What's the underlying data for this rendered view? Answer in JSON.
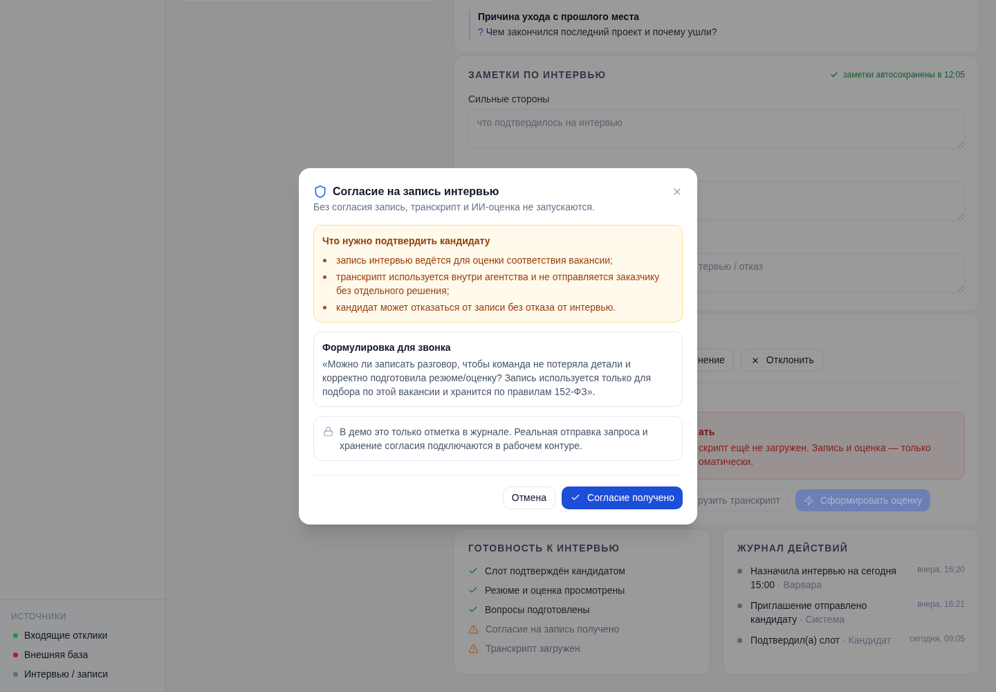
{
  "sidebar": {
    "sources": {
      "title": "ИСТОЧНИКИ",
      "items": [
        {
          "label": "Входящие отклики",
          "color": "#1a9a3c"
        },
        {
          "label": "Внешняя база",
          "color": "#a82424"
        },
        {
          "label": "Интервью / записи",
          "color": "#636b7e"
        }
      ]
    }
  },
  "questions": [
    {
      "title": "Причина ухода с прошлого места",
      "mark": "?",
      "text": "Чем закончился последний проект и почему ушли?"
    }
  ],
  "notes": {
    "title": "ЗАМЕТКИ ПО ИНТЕРВЬЮ",
    "autosave": "заметки автосохранены в 12:05",
    "fields": [
      {
        "kind": "full",
        "label": "Сильные стороны",
        "placeholder": "что подтвердилось на интервью"
      },
      {
        "kind": "covered"
      },
      {
        "kind": "covered",
        "placeholder": "тервью / отказ"
      }
    ]
  },
  "action_card": {
    "buttons": [
      {
        "kind": "covered",
        "label": "нение",
        "disabled": false
      },
      {
        "kind": "reject",
        "label": "Отклонить",
        "disabled": false
      }
    ],
    "alert": {
      "title": "ать",
      "lines": [
        "скрипт ещё не загружен. Запись и оценка — только",
        "оматически."
      ]
    },
    "footer_buttons": [
      {
        "kind": "covered",
        "label": "рузить транскрипт",
        "disabled": true
      },
      {
        "kind": "generate",
        "label": "Сформировать оценку",
        "disabled": true
      }
    ]
  },
  "readiness": {
    "title": "ГОТОВНОСТЬ К ИНТЕРВЬЮ",
    "items": [
      {
        "label": "Слот подтверждён кандидатом",
        "done": true
      },
      {
        "label": "Резюме и оценка просмотрены",
        "done": true
      },
      {
        "label": "Вопросы подготовлены",
        "done": true
      },
      {
        "label": "Согласие на запись получено",
        "done": false
      },
      {
        "label": "Транскрипт загружен",
        "done": false
      }
    ]
  },
  "journal": {
    "title": "ЖУРНАЛ ДЕЙСТВИЙ",
    "entries": [
      {
        "text": "Назначила интервью на сегодня 15:00",
        "author": "· Варвара",
        "time": "вчера, 16:20"
      },
      {
        "text": "Приглашение отправлено кандидату",
        "author": "· Система",
        "time": "вчера, 16:21"
      },
      {
        "text": "Подтвердил(а) слот",
        "author": "· Кандидат",
        "time": "сегодня, 09:05"
      }
    ]
  },
  "consent_dialog": {
    "title": "Согласие на запись интервью",
    "subtitle": "Без согласия запись, транскрипт и ИИ-оценка не запускаются.",
    "requirements": {
      "title": "Что нужно подтвердить кандидату",
      "items": [
        "запись интервью ведётся для оценки соответствия вакансии;",
        "транскрипт используется внутри агентства и не отправляется заказчику без отдельного решения;",
        "кандидат может отказаться от записи без отказа от интервью."
      ]
    },
    "script": {
      "title": "Формулировка для звонка",
      "text": "«Можно ли записать разговор, чтобы команда не потеряла детали и корректно подготовила резюме/оценку? Запись используется только для подбора по этой вакансии и хранится по правилам 152-ФЗ»."
    },
    "note": "В демо это только отметка в журнале. Реальная отправка запроса и хранение согласия подключаются в рабочем контуре.",
    "buttons": [
      {
        "kind": "secondary",
        "label": "Отмена"
      },
      {
        "kind": "primary",
        "label": "Согласие получено"
      }
    ]
  }
}
